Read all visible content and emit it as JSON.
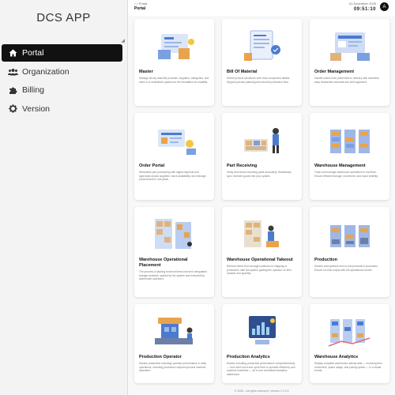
{
  "app": {
    "title": "DCS APP"
  },
  "sidebar": {
    "items": [
      {
        "label": "Portal",
        "icon": "home-icon",
        "active": true
      },
      {
        "label": "Organization",
        "icon": "users-icon",
        "active": false
      },
      {
        "label": "Billing",
        "icon": "puzzle-icon",
        "active": false
      },
      {
        "label": "Version",
        "icon": "gear-icon",
        "active": false
      }
    ]
  },
  "header": {
    "breadcrumb": [
      "⌂",
      "/",
      "Portal"
    ],
    "page_title": "Portal",
    "date": "01 December 2025",
    "time": "09:51:10",
    "avatar_initial": "A"
  },
  "cards": [
    {
      "title": "Master",
      "desc": "Manage all key data like products, suppliers, categories, and users in a centralized system as the foundation for usability.",
      "art": "master-illustration"
    },
    {
      "title": "Bill Of Material",
      "desc": "Define product structures with clear component details. Support precise planning and smooth production flow.",
      "art": "bom-illustration"
    },
    {
      "title": "Order Management",
      "desc": "Handle orders from placement to delivery with seamless easy transaction accurate and well organized.",
      "art": "order-illustration"
    },
    {
      "title": "Order Portal",
      "desc": "Streamline part purchasing with digital requests and approvals across suppliers, stock availability, and manage procurement in one place.",
      "art": "order-portal-illustration"
    },
    {
      "title": "Part Receiving",
      "desc": "Verify and record incoming parts accurately. Seamlessly sync received goods into your system.",
      "art": "receiving-illustration"
    },
    {
      "title": "Warehouse Management",
      "desc": "Track and manage warehouse operations in real time. Ensure efficient storage, movement, and stock visibility.",
      "art": "warehouse-illustration"
    },
    {
      "title": "Warehouse Operational Placement",
      "desc": "The process of placing received items into their designated storage locations, guided by the system and executed by warehouse operators.",
      "art": "placement-illustration"
    },
    {
      "title": "Warehouse Operational Takeout",
      "desc": "Retrieve items from storage locations for shipping or production, with the system guiding the operator on item location and quantity.",
      "art": "takeout-illustration"
    },
    {
      "title": "Production",
      "desc": "Monitor and optimize end-to-end production processes. Ensure on-time output with full operational control.",
      "art": "production-illustration"
    },
    {
      "title": "Production Operator",
      "desc": "Monitor production including operator performance in daily operations, including production output input and machine downtime.",
      "art": "operator-illustration"
    },
    {
      "title": "Production Analytics",
      "desc": "Monitor including production performance comprehensively — from shift count and cycle time to operator efficiency and machine downtime — all in one centralized analytics dashboard.",
      "art": "prod-analytics-illustration"
    },
    {
      "title": "Warehouse Analytics",
      "desc": "Display complete warehouse activity data — including item movement, space usage, and picking speed — in a visual format.",
      "art": "wh-analytics-illustration"
    }
  ],
  "footer": {
    "text": "© 2025 – All rights reserved | Version 1.0.0.0"
  }
}
